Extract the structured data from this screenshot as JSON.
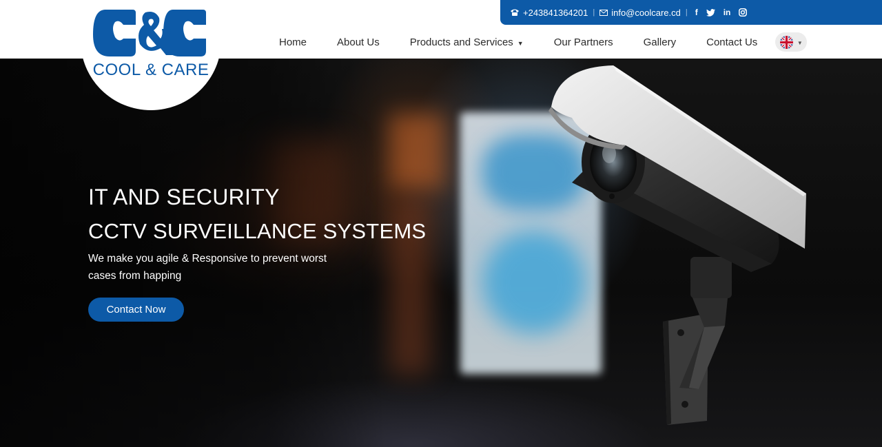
{
  "topbar": {
    "phone": "+243841364201",
    "email": "info@coolcare.cd",
    "social": [
      "f",
      "t",
      "in",
      "ig"
    ]
  },
  "logo": {
    "mark": "C&C",
    "tagline": "COOL & CARE"
  },
  "nav": {
    "items": [
      {
        "label": "Home"
      },
      {
        "label": "About Us"
      },
      {
        "label": "Products and Services"
      },
      {
        "label": "Our Partners"
      },
      {
        "label": "Gallery"
      },
      {
        "label": "Contact Us"
      }
    ],
    "language": "en-gb-flag"
  },
  "hero": {
    "title": "IT AND SECURITY",
    "subtitle": "CCTV SURVEILLANCE SYSTEMS",
    "description": "We make you agile & Responsive to prevent worst cases from happing",
    "cta_label": "Contact Now"
  },
  "colors": {
    "brand_blue": "#0d5aa7",
    "header_bg": "#ffffff",
    "hero_text": "#ffffff"
  }
}
